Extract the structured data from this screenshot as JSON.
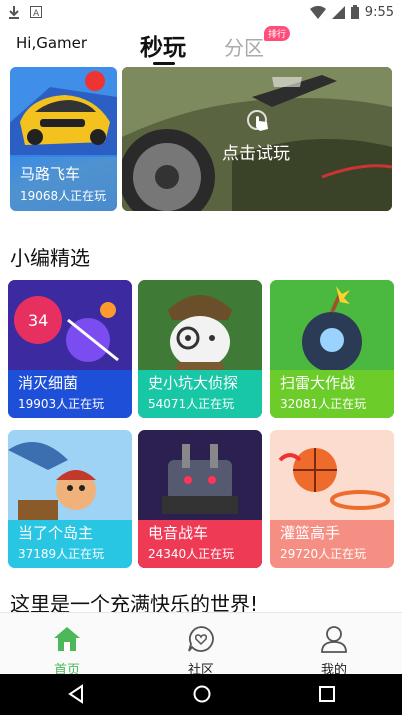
{
  "status_bar": {
    "time": "9:55",
    "left_icons": [
      "download-icon",
      "notification-a-icon"
    ],
    "right_icons": [
      "wifi-icon",
      "signal-icon",
      "battery-icon"
    ]
  },
  "header": {
    "greeting": "Hi,Gamer",
    "tabs": [
      {
        "label": "秒玩",
        "active": true
      },
      {
        "label": "分区",
        "active": false
      }
    ],
    "badge": "排行"
  },
  "featured": {
    "small_card": {
      "title": "马路飞车",
      "players": "19068人正在玩"
    },
    "big_card": {
      "cta": "点击试玩"
    }
  },
  "section_title": "小编精选",
  "games": [
    {
      "title": "消灭细菌",
      "players": "19903人正在玩",
      "band_color": "#1e4fd8"
    },
    {
      "title": "史小坑大侦探",
      "players": "54071人正在玩",
      "band_color": "#18c7a6"
    },
    {
      "title": "扫雷大作战",
      "players": "32081人正在玩",
      "band_color": "#6ccd2a"
    },
    {
      "title": "当了个岛主",
      "players": "37189人正在玩",
      "band_color": "#29c6e3"
    },
    {
      "title": "电音战车",
      "players": "24340人正在玩",
      "band_color": "#ee3a55"
    },
    {
      "title": "灌篮高手",
      "players": "29720人正在玩",
      "band_color": "#f58f84"
    }
  ],
  "slogan": "这里是一个充满快乐的世界!",
  "bottom_nav": [
    {
      "label": "首页",
      "icon": "home-icon",
      "active": true
    },
    {
      "label": "社区",
      "icon": "community-chat-icon",
      "active": false
    },
    {
      "label": "我的",
      "icon": "profile-icon",
      "active": false
    }
  ],
  "colors": {
    "active_nav": "#4cb85a",
    "badge": "#ff4d7a"
  }
}
